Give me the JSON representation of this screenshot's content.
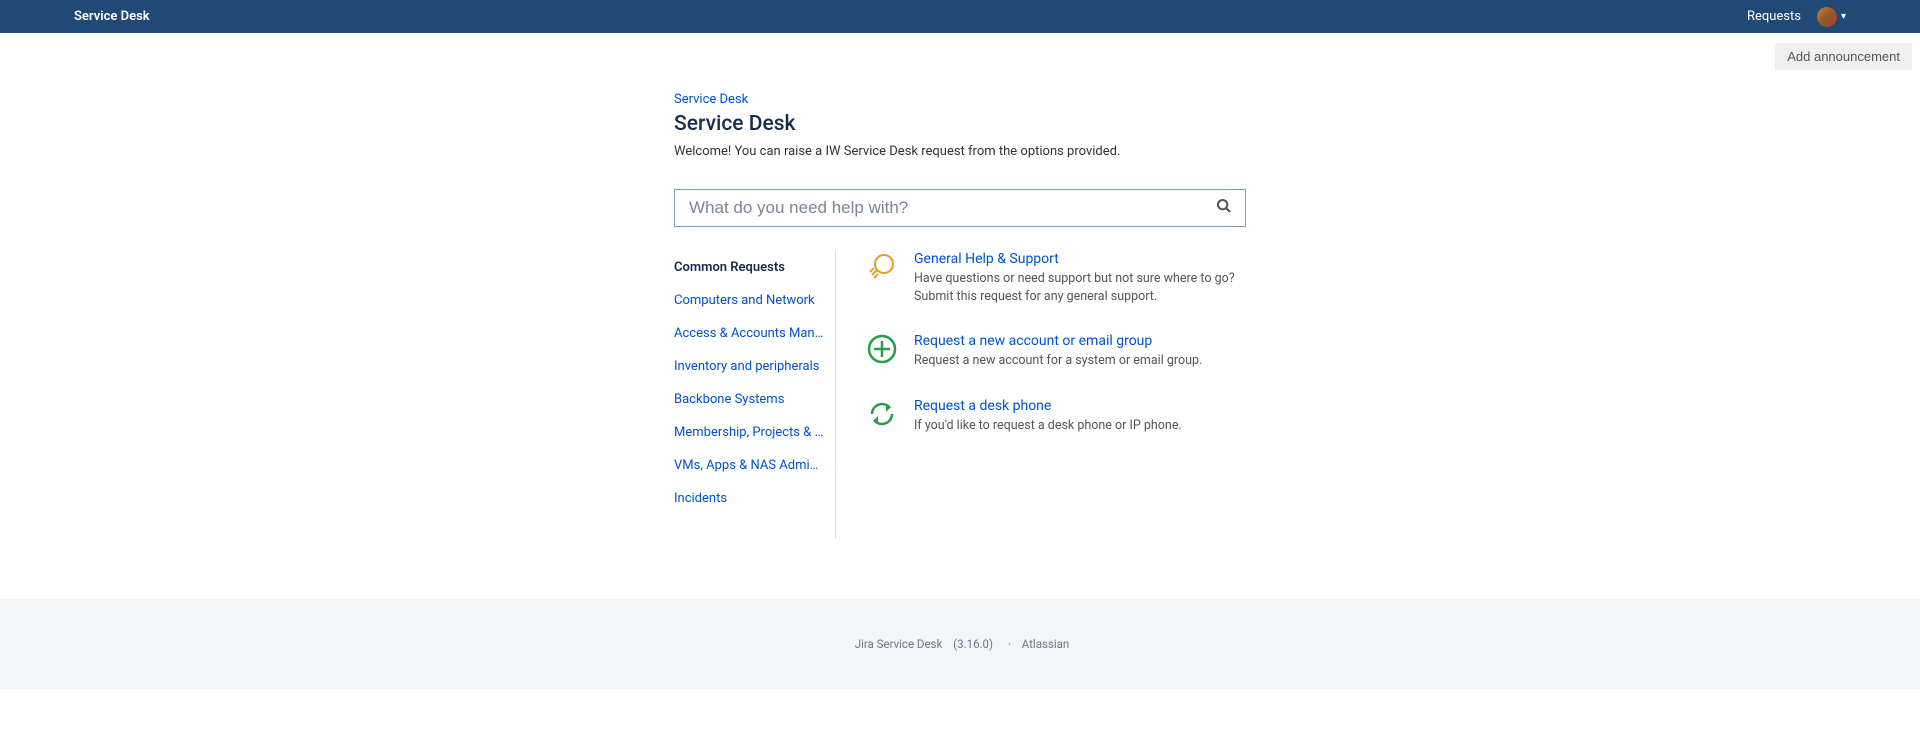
{
  "header": {
    "title": "Service Desk",
    "requests": "Requests"
  },
  "announcement_button": "Add announcement",
  "breadcrumb": "Service Desk",
  "page_title": "Service Desk",
  "welcome": "Welcome! You can raise a IW Service Desk request from the options provided.",
  "search": {
    "placeholder": "What do you need help with?"
  },
  "sidebar": {
    "items": [
      {
        "label": "Common Requests",
        "active": true
      },
      {
        "label": "Computers and Network"
      },
      {
        "label": "Access & Accounts Manag..."
      },
      {
        "label": "Inventory and peripherals"
      },
      {
        "label": "Backbone Systems"
      },
      {
        "label": "Membership, Projects & Pr..."
      },
      {
        "label": "VMs, Apps & NAS Adminis..."
      },
      {
        "label": "Incidents"
      }
    ]
  },
  "requests_list": [
    {
      "title": "General Help & Support",
      "desc": "Have questions or need support but not sure where to go? Submit this request for any general support."
    },
    {
      "title": "Request a new account or email group",
      "desc": "Request a new account for a system or email group."
    },
    {
      "title": "Request a desk phone",
      "desc": "If you'd like to request a desk phone or IP phone."
    }
  ],
  "footer": {
    "product": "Jira Service Desk",
    "version": "(3.16.0)",
    "vendor": "Atlassian"
  }
}
